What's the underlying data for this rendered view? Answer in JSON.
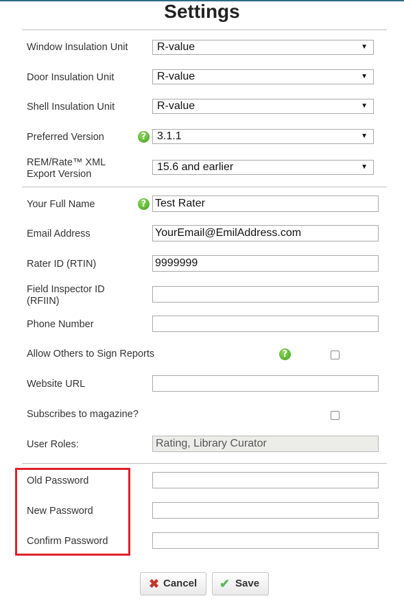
{
  "title": "Settings",
  "units": {
    "window": {
      "label": "Window Insulation Unit",
      "value": "R-value"
    },
    "door": {
      "label": "Door Insulation Unit",
      "value": "R-value"
    },
    "shell": {
      "label": "Shell Insulation Unit",
      "value": "R-value"
    },
    "version": {
      "label": "Preferred Version",
      "value": "3.1.1"
    },
    "xml": {
      "label_line1": "REM/Rate™ XML",
      "label_line2": "Export Version",
      "value": "15.6 and earlier"
    }
  },
  "profile": {
    "full_name": {
      "label": "Your Full Name",
      "value": "Test Rater"
    },
    "email": {
      "label": "Email Address",
      "value": "YourEmail@EmilAddress.com"
    },
    "rater_id": {
      "label": "Rater ID (RTIN)",
      "value": "9999999"
    },
    "field_inspector": {
      "label_line1": "Field Inspector ID",
      "label_line2": "(RFIIN)",
      "value": ""
    },
    "phone": {
      "label": "Phone Number",
      "value": ""
    },
    "allow_sign": {
      "label": "Allow Others to Sign Reports",
      "checked": false
    },
    "website": {
      "label": "Website URL",
      "value": ""
    },
    "magazine": {
      "label": "Subscribes to magazine?",
      "checked": false
    },
    "roles": {
      "label": "User Roles:",
      "value": "Rating, Library Curator"
    }
  },
  "password": {
    "old": {
      "label": "Old Password",
      "value": ""
    },
    "new": {
      "label": "New Password",
      "value": ""
    },
    "confirm": {
      "label": "Confirm Password",
      "value": ""
    }
  },
  "buttons": {
    "cancel": "Cancel",
    "save": "Save"
  },
  "icons": {
    "help": "help-icon",
    "cancel": "x-icon",
    "save": "checkmark-icon"
  },
  "colors": {
    "help_green": "#4caf2a",
    "highlight_red": "#e0202a",
    "cancel_red": "#c0392b",
    "save_green": "#5cb85c"
  }
}
